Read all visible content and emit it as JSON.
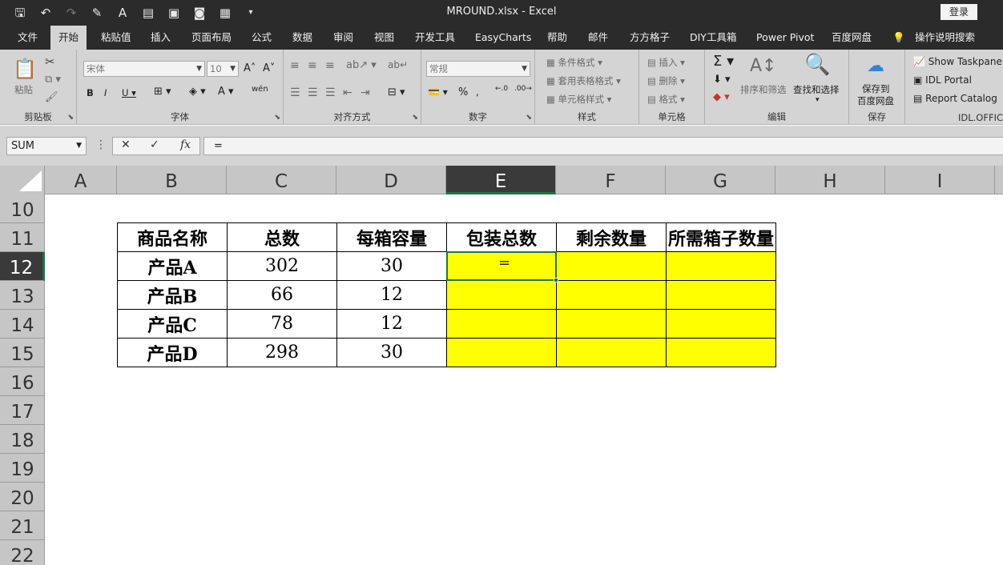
{
  "titlebar": {
    "title": "MROUND.xlsx  -  Excel",
    "login": "登录"
  },
  "tabs": [
    {
      "label": "文件",
      "active": false
    },
    {
      "label": "开始",
      "active": true
    },
    {
      "label": "粘贴值",
      "active": false
    },
    {
      "label": "插入",
      "active": false
    },
    {
      "label": "页面布局",
      "active": false
    },
    {
      "label": "公式",
      "active": false
    },
    {
      "label": "数据",
      "active": false
    },
    {
      "label": "审阅",
      "active": false
    },
    {
      "label": "视图",
      "active": false
    },
    {
      "label": "开发工具",
      "active": false
    },
    {
      "label": "EasyCharts",
      "active": false
    },
    {
      "label": "帮助",
      "active": false
    },
    {
      "label": "邮件",
      "active": false
    },
    {
      "label": "方方格子",
      "active": false
    },
    {
      "label": "DIY工具箱",
      "active": false
    },
    {
      "label": "Power Pivot",
      "active": false
    },
    {
      "label": "百度网盘",
      "active": false
    },
    {
      "label": "操作说明搜索",
      "active": false
    }
  ],
  "ribbon": {
    "clipboard": {
      "paste": "粘贴",
      "label": "剪贴板"
    },
    "font": {
      "name": "宋体",
      "size": "10",
      "label": "字体",
      "phonetic": "wén"
    },
    "alignment": {
      "label": "对齐方式"
    },
    "number": {
      "format": "常规",
      "label": "数字"
    },
    "styles": {
      "conditional": "条件格式",
      "table": "套用表格格式",
      "cell": "单元格样式",
      "label": "样式"
    },
    "cells": {
      "insert": "插入",
      "delete": "删除",
      "format": "格式",
      "label": "单元格"
    },
    "editing": {
      "sort": "排序和筛选",
      "find": "查找和选择",
      "label": "编辑"
    },
    "save": {
      "line1": "保存到",
      "line2": "百度网盘",
      "label": "保存"
    },
    "idl": {
      "taskpane": "Show Taskpane",
      "portal": "IDL Portal",
      "catalog": "Report Catalog",
      "label": "IDL.OFFIC"
    }
  },
  "formula_bar": {
    "name_box": "SUM",
    "formula": "="
  },
  "columns": [
    "A",
    "B",
    "C",
    "D",
    "E",
    "F",
    "G",
    "H",
    "I"
  ],
  "selected_column": "E",
  "rows": [
    "10",
    "11",
    "12",
    "13",
    "14",
    "15",
    "16",
    "17",
    "18",
    "19",
    "20",
    "21",
    "22"
  ],
  "selected_row": "12",
  "table": {
    "headers": [
      "商品名称",
      "总数",
      "每箱容量",
      "包装总数",
      "剩余数量",
      "所需箱子数量"
    ],
    "rows": [
      {
        "name": "产品A",
        "total": "302",
        "capacity": "30",
        "cell_e": "="
      },
      {
        "name": "产品B",
        "total": "66",
        "capacity": "12"
      },
      {
        "name": "产品C",
        "total": "78",
        "capacity": "12"
      },
      {
        "name": "产品D",
        "total": "298",
        "capacity": "30"
      }
    ],
    "highlight_color": "#ffff00"
  }
}
